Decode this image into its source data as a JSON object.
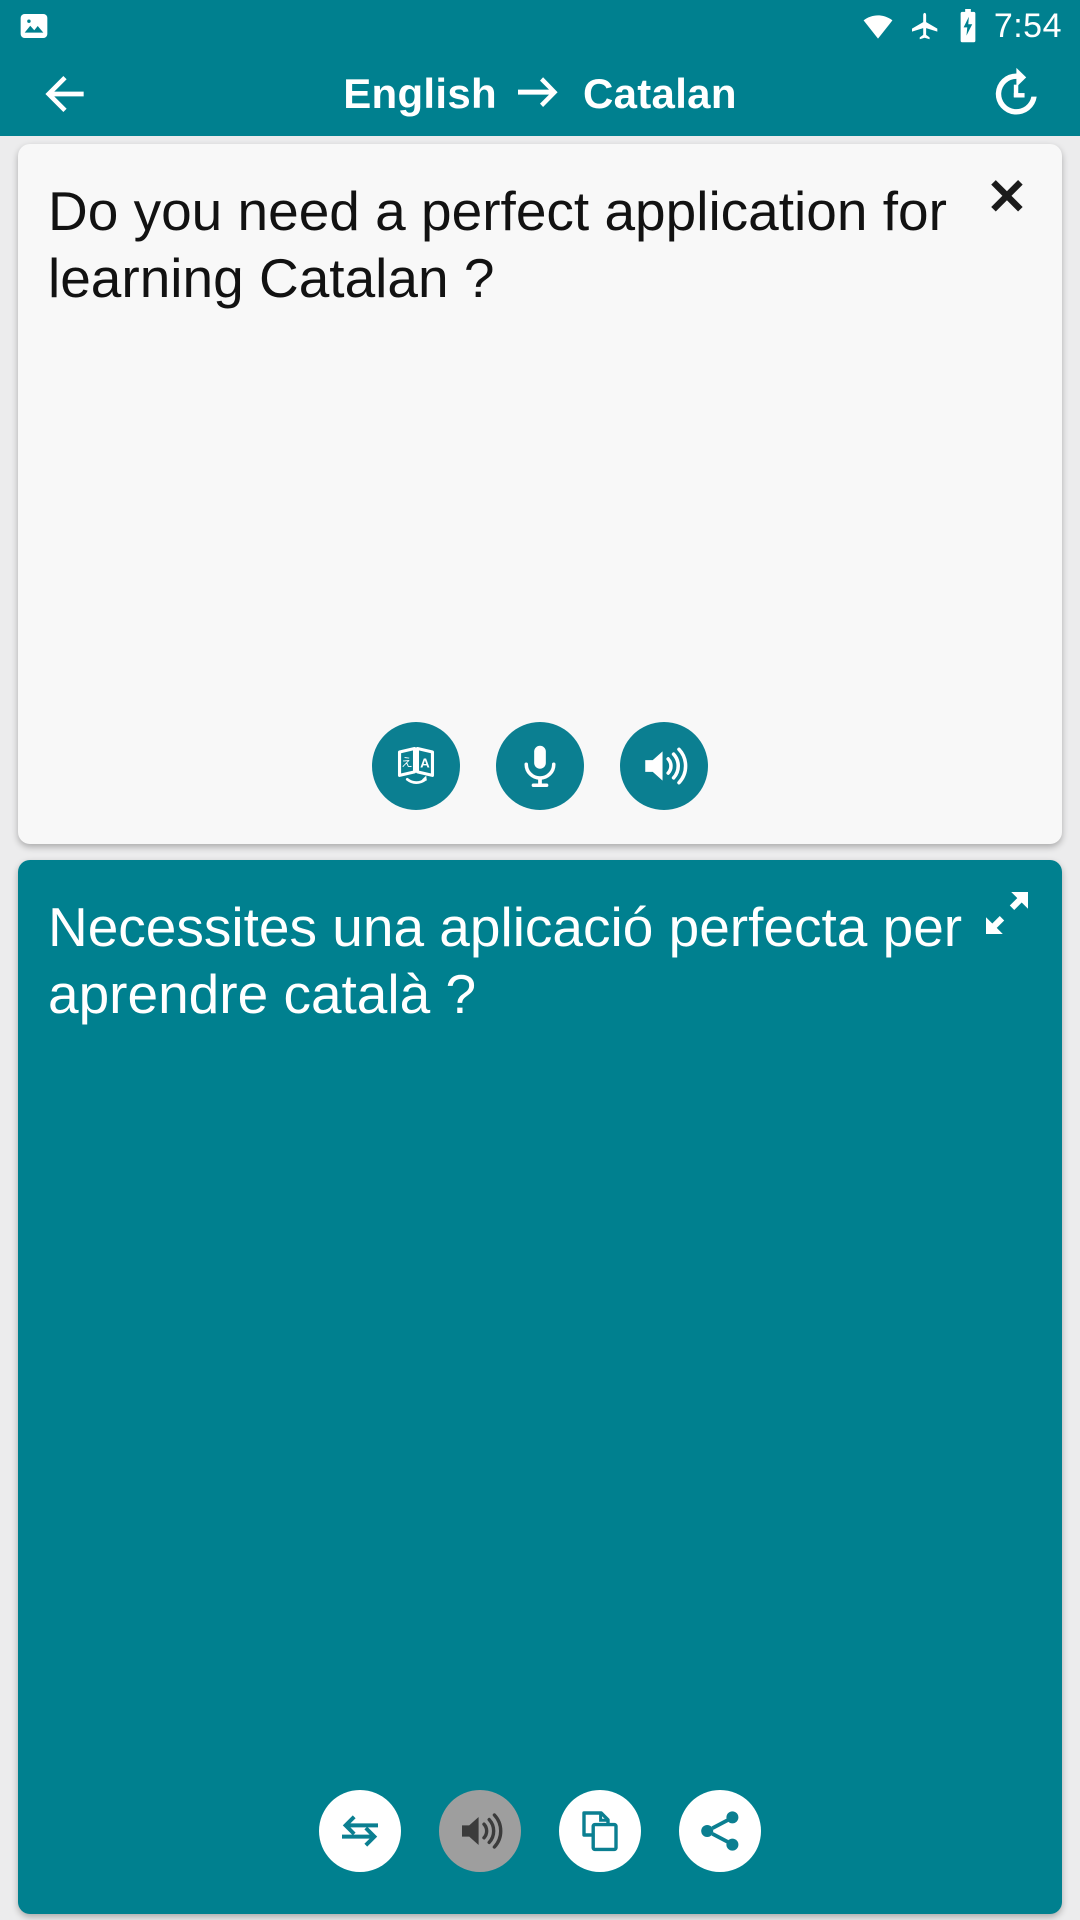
{
  "status_bar": {
    "time": "7:54",
    "icons": {
      "notification": "image-icon",
      "wifi": "wifi-icon",
      "airplane": "airplane-mode-icon",
      "battery": "battery-charging-icon"
    }
  },
  "app_bar": {
    "back_icon": "back-arrow-icon",
    "source_language": "English",
    "arrow": "→",
    "target_language": "Catalan",
    "history_icon": "history-icon"
  },
  "source_card": {
    "text": "Do you need a perfect application for learning Catalan ?",
    "close_icon": "close-icon",
    "buttons": [
      {
        "name": "translate-button",
        "icon": "translate-icon",
        "style": "teal"
      },
      {
        "name": "microphone-button",
        "icon": "microphone-icon",
        "style": "teal"
      },
      {
        "name": "speak-button",
        "icon": "speaker-icon",
        "style": "teal"
      }
    ]
  },
  "target_card": {
    "text": "Necessites una aplicació perfecta per aprendre català ?",
    "expand_icon": "expand-icon",
    "buttons": [
      {
        "name": "swap-languages-button",
        "icon": "swap-arrows-icon",
        "style": "white"
      },
      {
        "name": "speak-translation-button",
        "icon": "speaker-icon",
        "style": "grey"
      },
      {
        "name": "copy-button",
        "icon": "copy-icon",
        "style": "white"
      },
      {
        "name": "share-button",
        "icon": "share-icon",
        "style": "white"
      }
    ]
  },
  "colors": {
    "primary_teal": "#00808f",
    "fab_teal": "#0b7f91",
    "card_light": "#f8f8f8",
    "page_background": "#ececed",
    "disabled_grey": "#9e9e9e",
    "text_dark": "#121212",
    "text_light": "#ffffff"
  }
}
